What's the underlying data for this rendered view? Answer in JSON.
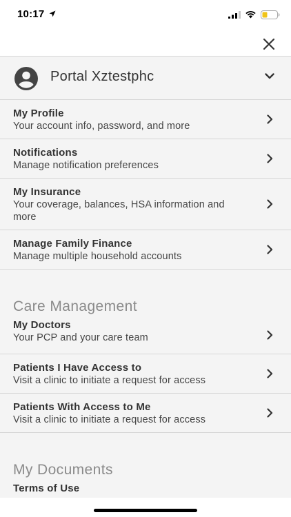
{
  "status_bar": {
    "time": "10:17"
  },
  "account": {
    "name": "Portal Xztestphc"
  },
  "menu_items": [
    {
      "title": "My Profile",
      "subtitle": "Your account info, password, and more"
    },
    {
      "title": "Notifications",
      "subtitle": "Manage notification preferences"
    },
    {
      "title": "My Insurance",
      "subtitle": "Your coverage, balances, HSA information and more"
    },
    {
      "title": "Manage Family Finance",
      "subtitle": "Manage multiple household accounts"
    }
  ],
  "care_management": {
    "header": "Care Management",
    "items": [
      {
        "title": "My Doctors",
        "subtitle": "Your PCP and your care team"
      },
      {
        "title": "Patients I Have Access to",
        "subtitle": "Visit a clinic to initiate a request for access"
      },
      {
        "title": "Patients With Access to Me",
        "subtitle": "Visit a clinic to initiate a request for access"
      }
    ]
  },
  "my_documents": {
    "header": "My Documents",
    "items": [
      {
        "title": "Terms of Use"
      }
    ]
  },
  "icons": {
    "close": "close-icon",
    "avatar": "user-circle-icon",
    "expand": "chevron-down-icon",
    "navigate": "chevron-right-icon"
  },
  "colors": {
    "background": "#f4f4f4",
    "divider": "#d6d6d6",
    "text": "#333333",
    "section_header": "#8a8a8a"
  }
}
